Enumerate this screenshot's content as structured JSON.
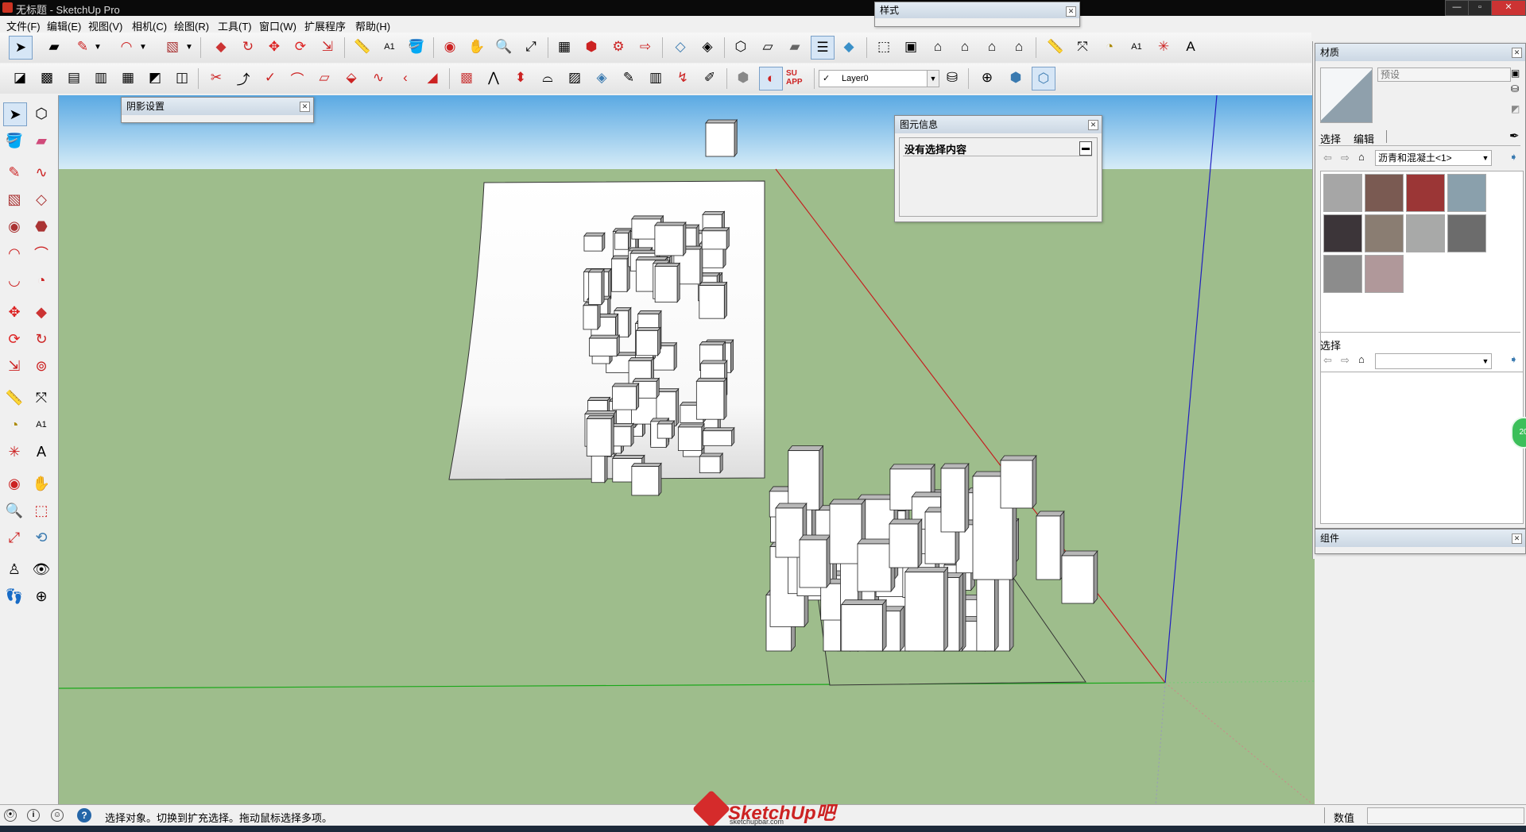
{
  "window": {
    "title": "无标题 - SketchUp Pro"
  },
  "menu": [
    "文件(F)",
    "编辑(E)",
    "视图(V)",
    "相机(C)",
    "绘图(R)",
    "工具(T)",
    "窗口(W)",
    "扩展程序",
    "帮助(H)"
  ],
  "toolbar2": {
    "layer_name": "Layer0",
    "app_badge": "SU APP"
  },
  "dialogs": {
    "style": {
      "title": "样式"
    },
    "shadow": {
      "title": "阴影设置"
    },
    "entity_info": {
      "title": "图元信息",
      "content": "没有选择内容"
    }
  },
  "tray": {
    "materials": {
      "title": "材质",
      "name_field_placeholder": "预设",
      "tab_select": "选择",
      "tab_edit": "编辑",
      "library": "沥青和混凝土<1>",
      "swatches": [
        "#a6a6a6",
        "#7a5a52",
        "#9b3636",
        "#8aa0ac",
        "#3c3539",
        "#8a7d72",
        "#a8a9a8",
        "#6c6c6c",
        "#8c8c8c",
        "#b0989a"
      ]
    },
    "secondary_select": {
      "title": "选择",
      "library": ""
    },
    "components": {
      "title": "组件"
    },
    "side_badge": "20"
  },
  "status": {
    "message": "选择对象。切换到扩充选择。拖动鼠标选择多项。",
    "measure_label": "数值",
    "measure_value": ""
  },
  "watermark": {
    "brand": "SketchUp吧",
    "url": "sketchupbar.com"
  },
  "colors": {
    "sky_top": "#5aa9e3",
    "sky_bottom": "#d6ecf7",
    "ground": "#9ebd8c",
    "axis_red": "#c42020",
    "axis_green": "#1aa81a",
    "axis_blue": "#2020c0",
    "accent": "#d6e6f6"
  }
}
